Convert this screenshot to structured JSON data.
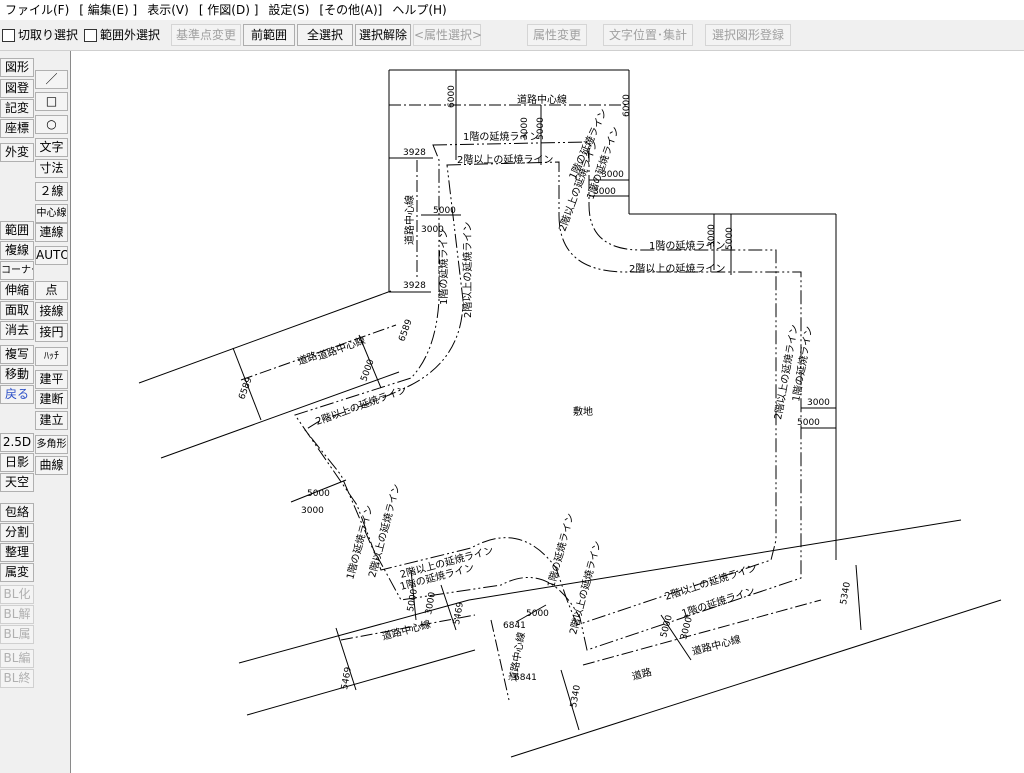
{
  "menubar": [
    "ファイル(F)",
    "[ 編集(E) ]",
    "表示(V)",
    "[ 作図(D) ]",
    "設定(S)",
    "[その他(A)]",
    "ヘルプ(H)"
  ],
  "toolbar": {
    "cut_select": "切取り選択",
    "outside_select": "範囲外選択",
    "base_point_change": "基準点変更",
    "prev_range": "前範囲",
    "select_all": "全選択",
    "deselect": "選択解除",
    "attr_select": "<属性選択>",
    "attr_change": "属性変更",
    "text_pos_tally": "文字位置･集計",
    "register_shape": "選択図形登録"
  },
  "tools_left": [
    "図形",
    "図登",
    "記変",
    "座標",
    "外変",
    "範囲",
    "複線",
    "コーナー",
    "伸縮",
    "面取",
    "消去",
    "複写",
    "移動",
    "戻る",
    "2.5D",
    "日影",
    "天空",
    "包絡",
    "分割",
    "整理",
    "属変",
    "BL化",
    "BL解",
    "BL属",
    "BL編",
    "BL終"
  ],
  "tools_right": [
    "／",
    "□",
    "○",
    "文字",
    "寸法",
    "２線",
    "中心線",
    "連線",
    "AUTO",
    "点",
    "接線",
    "接円",
    "ﾊｯﾁ",
    "建平",
    "建断",
    "建立",
    "多角形",
    "曲線"
  ],
  "drawing": {
    "site_label": "敷地",
    "road": "道路",
    "road_center": "道路中心線",
    "first_floor_line": "1階の延焼ライン",
    "upper_floor_line": "2階以上の延焼ライン",
    "dims": {
      "d6000": "6000",
      "d3000": "3000",
      "d5000": "5000",
      "d3928": "3928",
      "d6589": "6589",
      "d5469": "5469",
      "d5340": "5340",
      "d6841": "6841"
    }
  },
  "colors": {
    "menu_bg": "#ffffff",
    "toolbar_bg": "#f0f0f0",
    "canvas_bg": "#ffffff",
    "line": "#000000",
    "highlight_text": "#2b4fc7"
  }
}
